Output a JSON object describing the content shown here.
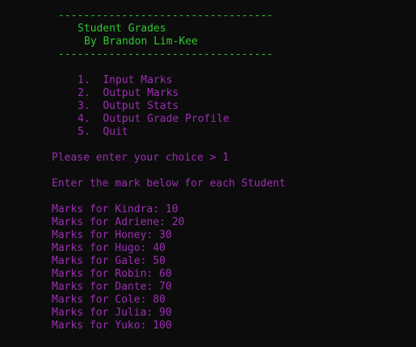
{
  "colors": {
    "background": "#0c0c0c",
    "header_text": "#31c631",
    "body_text": "#9b2fb0"
  },
  "header": {
    "rule_top": "----------------------------------",
    "title": "Student Grades",
    "author": "By Brandon Lim-Kee",
    "rule_bottom": "----------------------------------"
  },
  "menu": {
    "items": [
      {
        "number": "1.",
        "label": "Input Marks"
      },
      {
        "number": "2.",
        "label": "Output Marks"
      },
      {
        "number": "3.",
        "label": "Output Stats"
      },
      {
        "number": "4.",
        "label": "Output Grade Profile"
      },
      {
        "number": "5.",
        "label": "Quit"
      }
    ]
  },
  "prompt": {
    "text": "Please enter your choice > 1"
  },
  "instruction": {
    "text": "Enter the mark below for each Student"
  },
  "marks": [
    "Marks for Kindra: 10",
    "Marks for Adriene: 20",
    "Marks for Honey: 30",
    "Marks for Hugo: 40",
    "Marks for Gale: 50",
    "Marks for Robin: 60",
    "Marks for Dante: 70",
    "Marks for Cole: 80",
    "Marks for Julia: 90",
    "Marks for Yuko: 100"
  ]
}
